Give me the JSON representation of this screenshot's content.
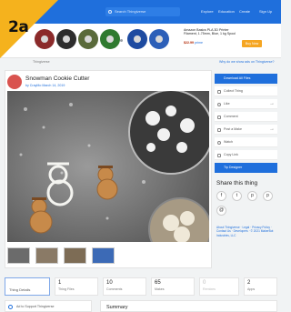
{
  "header": {
    "search_placeholder": "Search Thingiverse",
    "nav": [
      "Explore",
      "Education",
      "Create",
      "Sign Up"
    ]
  },
  "badge": "2a",
  "ad": {
    "spool_colors": [
      "#8b2a2a",
      "#2d2d2d",
      "#5a6a3a",
      "#2f7a2f",
      "#1d4aa0",
      "#2c5fb8",
      "#1b3a80"
    ],
    "product_title": "Amazon Basics PLA 3D Printer Filament, 1.75mm, Blue, 1 kg Spool",
    "price": "$22.99",
    "prime": "prime",
    "buy_label": "Buy Now",
    "why_link": "Why do we show ads on Thingiverse?",
    "prev_link": "Thingiverse"
  },
  "thing": {
    "title": "Snowman Cookie Cutter",
    "byline": "by CrayMo March 14, 2019"
  },
  "sidebar": {
    "download_label": "Download All Files",
    "items": [
      {
        "label": "Collect Thing",
        "arrow": ""
      },
      {
        "label": "Like",
        "arrow": "→"
      },
      {
        "label": "Comment",
        "arrow": ""
      },
      {
        "label": "Post a Make",
        "arrow": "→"
      },
      {
        "label": "Watch",
        "arrow": ""
      },
      {
        "label": "Copy Link",
        "arrow": ""
      }
    ],
    "tip_label": "Tip Designer",
    "share_title": "Share this thing",
    "share_icons": [
      "f",
      "t",
      "p",
      "p",
      "@"
    ],
    "footer": "About Thingiverse · Legal · Privacy Policy · Contact Us · Developers · © 2021 MakerBot Industries, LLC"
  },
  "stats": [
    {
      "num": "",
      "label": "Thing Details"
    },
    {
      "num": "1",
      "label": "Thing Files"
    },
    {
      "num": "10",
      "label": "Comments"
    },
    {
      "num": "65",
      "label": "Makes"
    },
    {
      "num": "0",
      "label": "Remixes"
    },
    {
      "num": "2",
      "label": "Apps"
    }
  ],
  "bottom": {
    "support_label": "Ad to Support Thingiverse",
    "summary_title": "Summary"
  }
}
